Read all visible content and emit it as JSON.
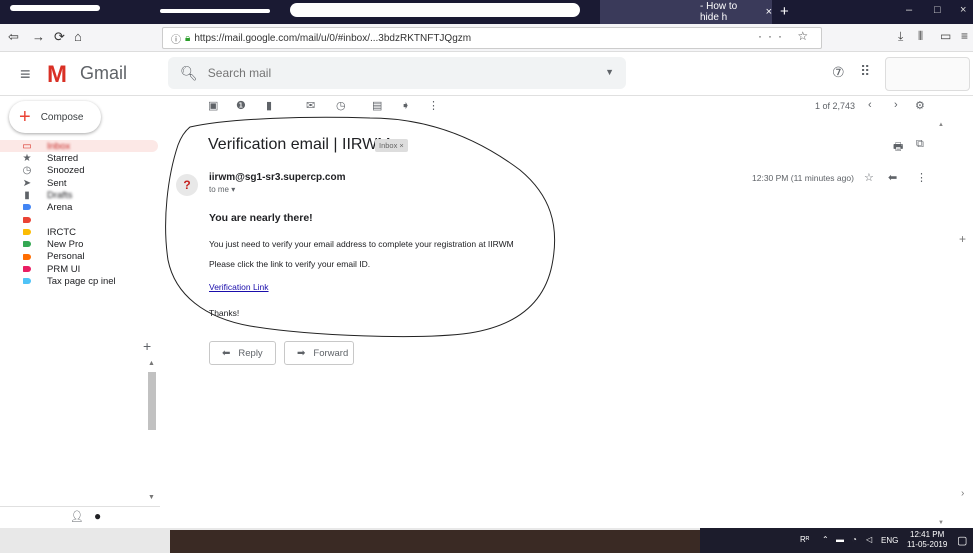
{
  "browser": {
    "tab_title": "- How to hide h",
    "tab_close": "×",
    "new_tab": "+",
    "window_controls": [
      "–",
      "□",
      "×"
    ],
    "url": "https://mail.google.com/mail/u/0/#inbox/...3bdzRKTNFTJQgzm",
    "nav_icons": [
      "back-icon",
      "forward-icon",
      "reload-icon",
      "home-icon"
    ]
  },
  "gmail": {
    "app_name": "Gmail",
    "search_placeholder": "Search mail"
  },
  "sidebar": {
    "compose_label": "Compose",
    "labels": [
      {
        "label": "Inbox",
        "icon": "inbox-icon"
      },
      {
        "label": "Starred",
        "icon": "star-icon"
      },
      {
        "label": "Snoozed",
        "icon": "clock-icon"
      },
      {
        "label": "Sent",
        "icon": "send-icon"
      },
      {
        "label": "Drafts",
        "icon": "draft-icon"
      },
      {
        "label": "Arena",
        "color": "#4285f4"
      },
      {
        "label": "",
        "color": "#ea4335"
      },
      {
        "label": "IRCTC",
        "color": "#fbbc04"
      },
      {
        "label": "New Pro",
        "color": "#34a853"
      },
      {
        "label": "Personal",
        "color": "#ff6d00"
      },
      {
        "label": "PRM UI",
        "color": "#e91e63"
      },
      {
        "label": "Tax page cp inel",
        "color": "#4fc3f7"
      }
    ],
    "hangouts_add": "+"
  },
  "toolbar": {
    "pager_text": "1 of 2,743",
    "icons": [
      "archive-icon",
      "report-spam-icon",
      "delete-icon",
      "mark-unread-icon",
      "snooze-icon",
      "move-to-icon",
      "label-icon",
      "more-icon"
    ]
  },
  "email": {
    "subject": "Verification email | IIRWM",
    "chip": "Inbox ×",
    "sender": "iirwm@sg1-sr3.supercp.com",
    "to": "to me ▾",
    "avatar_letter": "?",
    "time": "12:30 PM (11 minutes ago)",
    "heading": "You are nearly there!",
    "line1": "You just need to verify your email address to complete your registration at IIRWM",
    "line2": "Please click the link to verify your email ID.",
    "link": "Verification Link",
    "signoff": "Thanks!",
    "reply_label": "Reply",
    "forward_label": "Forward"
  },
  "taskbar": {
    "lang": "ENG",
    "time": "12:41 PM",
    "date": "11-05-2019"
  }
}
